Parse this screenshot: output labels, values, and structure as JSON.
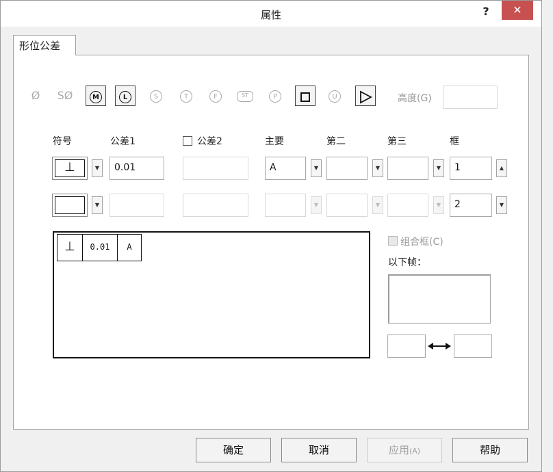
{
  "window": {
    "title": "属性",
    "help_label": "?",
    "close_label": "✕"
  },
  "tab": {
    "label": "形位公差"
  },
  "symbols": {
    "diameter": "Ø",
    "spherical_diameter": "SØ",
    "m": "M",
    "l": "L",
    "s": "S",
    "t": "T",
    "f": "F",
    "st": "ST",
    "p": "P",
    "u": "U",
    "height_label": "高度(G)",
    "height_value": ""
  },
  "headers": {
    "symbol": "符号",
    "tol1": "公差1",
    "tol2": "公差2",
    "primary": "主要",
    "secondary": "第二",
    "tertiary": "第三",
    "frame": "框"
  },
  "row1": {
    "symbol": "⊥",
    "tol1": "0.01",
    "tol2": "",
    "primary": "A",
    "secondary": "",
    "tertiary": "",
    "frame": "1"
  },
  "row2": {
    "symbol": "",
    "tol1": "",
    "tol2": "",
    "primary": "",
    "secondary": "",
    "tertiary": "",
    "frame": "2"
  },
  "preview": {
    "symbol": "⊥",
    "tolerance": "0.01",
    "datum": "A"
  },
  "options": {
    "composite_label": "组合框(C)",
    "below_frame_label": "以下帧：",
    "left_value": "",
    "right_value": ""
  },
  "buttons": {
    "ok": "确定",
    "cancel": "取消",
    "apply": "应用",
    "apply_hotkey": "(A)",
    "help": "帮助"
  }
}
